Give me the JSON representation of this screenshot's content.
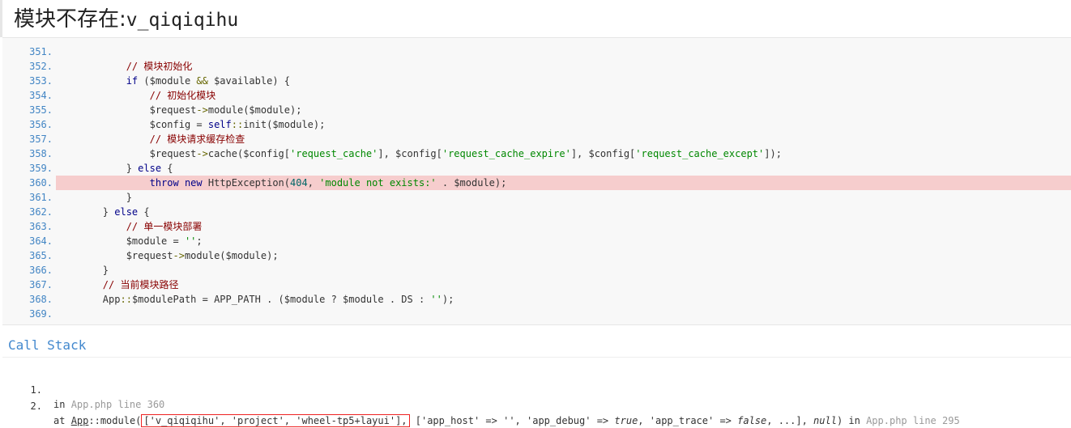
{
  "page": {
    "title_prefix": "模块不存在:",
    "title_module": "v_qiqiqihu"
  },
  "source": {
    "highlight_line": "360.",
    "lines": [
      {
        "num": "351.",
        "text": ""
      },
      {
        "num": "352.",
        "text": "            // 模块初始化"
      },
      {
        "num": "353.",
        "text": "            if ($module && $available) {"
      },
      {
        "num": "354.",
        "text": "                // 初始化模块"
      },
      {
        "num": "355.",
        "text": "                $request->module($module);"
      },
      {
        "num": "356.",
        "text": "                $config = self::init($module);"
      },
      {
        "num": "357.",
        "text": "                // 模块请求缓存检查"
      },
      {
        "num": "358.",
        "text": "                $request->cache($config['request_cache'], $config['request_cache_expire'], $config['request_cache_except']);"
      },
      {
        "num": "359.",
        "text": "            } else {"
      },
      {
        "num": "360.",
        "text": "                throw new HttpException(404, 'module not exists:' . $module);"
      },
      {
        "num": "361.",
        "text": "            }"
      },
      {
        "num": "362.",
        "text": "        } else {"
      },
      {
        "num": "363.",
        "text": "            // 单一模块部署"
      },
      {
        "num": "364.",
        "text": "            $module = '';"
      },
      {
        "num": "365.",
        "text": "            $request->module($module);"
      },
      {
        "num": "366.",
        "text": "        }"
      },
      {
        "num": "367.",
        "text": "        // 当前模块路径"
      },
      {
        "num": "368.",
        "text": "        App::$modulePath = APP_PATH . ($module ? $module . DS : '');"
      },
      {
        "num": "369.",
        "text": ""
      }
    ]
  },
  "call_stack": {
    "title": "Call Stack",
    "items": [
      {
        "idx": "1.",
        "pre": "in ",
        "file": "App.php line 360"
      },
      {
        "idx": "2.",
        "pre": "at ",
        "cls": "App",
        "method": "::module(",
        "boxed": "['v_qiqiqihu', 'project', 'wheel-tp5+layui'],",
        "args_a": " ['app_host' => '', 'app_debug' => ",
        "true1": "true",
        "args_b": ", 'app_trace' => ",
        "false1": "false",
        "args_c": ", ...], ",
        "null1": "null",
        "args_d": ") in ",
        "file": "App.php line 295"
      }
    ]
  }
}
